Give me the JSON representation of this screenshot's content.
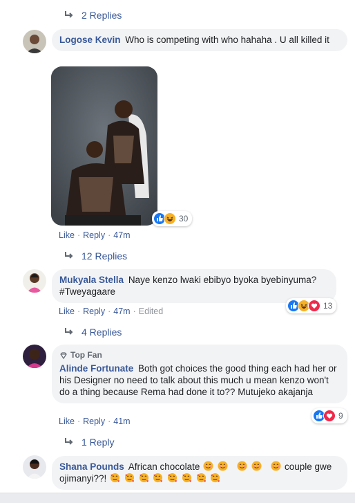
{
  "replies_top": {
    "label": "2 Replies"
  },
  "comments": [
    {
      "author": "Logose Kevin",
      "text": "Who is competing with who hahaha . U all killed it",
      "reactions_count": "30",
      "like": "Like",
      "reply": "Reply",
      "time": "47m",
      "replies_label": "12 Replies"
    },
    {
      "author": "Mukyala Stella",
      "text": "Naye kenzo lwaki ebibyo byoka byebinyuma? #Tweyagaare",
      "reactions_count": "13",
      "like": "Like",
      "reply": "Reply",
      "time": "47m",
      "edited": "Edited",
      "replies_label": "4 Replies"
    },
    {
      "badge": "Top Fan",
      "author": "Alinde Fortunate",
      "text": "Both got choices the good thing each had her or his Designer no need to talk about this much u mean kenzo won't do a thing because Rema had done it to?? Mutujeko akajanja",
      "reactions_count": "9",
      "like": "Like",
      "reply": "Reply",
      "time": "41m",
      "replies_label": "1 Reply"
    },
    {
      "author": "Shana Pounds",
      "text_a": "African chocolate",
      "text_b": "couple gwe ojimanyi??!"
    }
  ],
  "colors": {
    "link": "#385898",
    "bubble": "#f2f3f5",
    "like_blue": "#1877f2",
    "love_red": "#f0284a",
    "haha_yellow": "#f7b125"
  }
}
